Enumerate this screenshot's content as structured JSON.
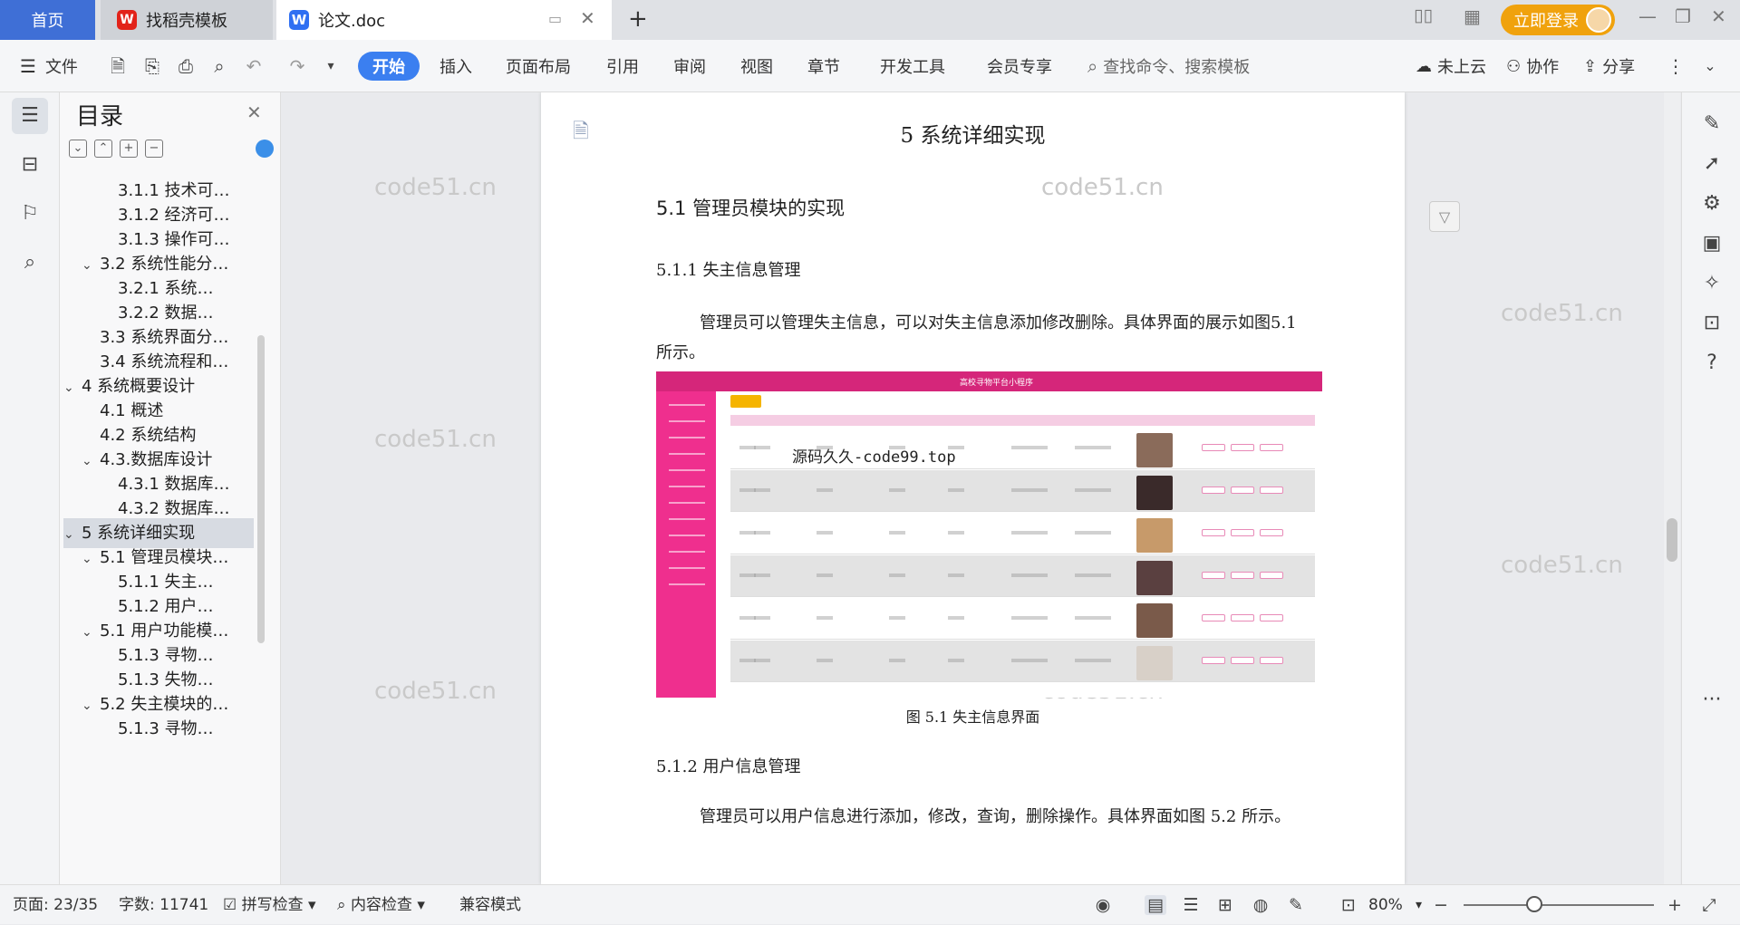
{
  "tabs": {
    "home": "首页",
    "templates": "找稻壳模板",
    "document": "论文.doc",
    "new_tab": "+"
  },
  "account": {
    "login": "立即登录"
  },
  "toolbar": {
    "file_menu": "文件",
    "ribbon_tabs": [
      "开始",
      "插入",
      "页面布局",
      "引用",
      "审阅",
      "视图",
      "章节",
      "开发工具",
      "会员专享"
    ],
    "search_placeholder": "查找命令、搜索模板",
    "cloud": "未上云",
    "collab": "协作",
    "share": "分享"
  },
  "toc": {
    "title": "目录",
    "items": [
      {
        "label": "3.1.1 技术可…",
        "level": 3
      },
      {
        "label": "3.1.2 经济可…",
        "level": 3
      },
      {
        "label": "3.1.3 操作可…",
        "level": 3
      },
      {
        "label": "3.2 系统性能分…",
        "level": 2,
        "expanded": true
      },
      {
        "label": "3.2.1  系统…",
        "level": 3
      },
      {
        "label": "3.2.2  数据…",
        "level": 3
      },
      {
        "label": "3.3 系统界面分…",
        "level": 2
      },
      {
        "label": "3.4 系统流程和…",
        "level": 2
      },
      {
        "label": "4 系统概要设计",
        "level": 1,
        "expanded": true
      },
      {
        "label": "4.1 概述",
        "level": 2
      },
      {
        "label": "4.2 系统结构",
        "level": 2
      },
      {
        "label": "4.3.数据库设计",
        "level": 2,
        "expanded": true
      },
      {
        "label": "4.3.1 数据库…",
        "level": 3
      },
      {
        "label": "4.3.2 数据库…",
        "level": 3
      },
      {
        "label": "5 系统详细实现",
        "level": 1,
        "expanded": true,
        "selected": true
      },
      {
        "label": "5.1  管理员模块…",
        "level": 2,
        "expanded": true
      },
      {
        "label": "5.1.1  失主…",
        "level": 3
      },
      {
        "label": "5.1.2  用户…",
        "level": 3
      },
      {
        "label": "5.1 用户功能模…",
        "level": 2,
        "expanded": true
      },
      {
        "label": "5.1.3  寻物…",
        "level": 3
      },
      {
        "label": "5.1.3  失物…",
        "level": 3
      },
      {
        "label": "5.2 失主模块的…",
        "level": 2,
        "expanded": true
      },
      {
        "label": "5.1.3  寻物…",
        "level": 3
      }
    ]
  },
  "document": {
    "chapter_title": "5 系统详细实现",
    "section_51": "5.1  管理员模块的实现",
    "section_511": "5.1.1  失主信息管理",
    "para_1": "管理员可以管理失主信息，可以对失主信息添加修改删除。具体界面的展示如图5.1 所示。",
    "figure_overlay": "源码久久-code99.top",
    "figure_title": "高校寻物平台小程序",
    "figure_caption": "图 5.1  失主信息界面",
    "section_512": "5.1.2  用户信息管理",
    "para_2": "管理员可以用户信息进行添加，修改，查询，删除操作。具体界面如图 5.2 所示。",
    "watermark": "code51.cn"
  },
  "status": {
    "page": "页面: 23/35",
    "words": "字数: 11741",
    "spellcheck": "拼写检查",
    "content_check": "内容检查",
    "compat": "兼容模式",
    "zoom": "80%"
  }
}
